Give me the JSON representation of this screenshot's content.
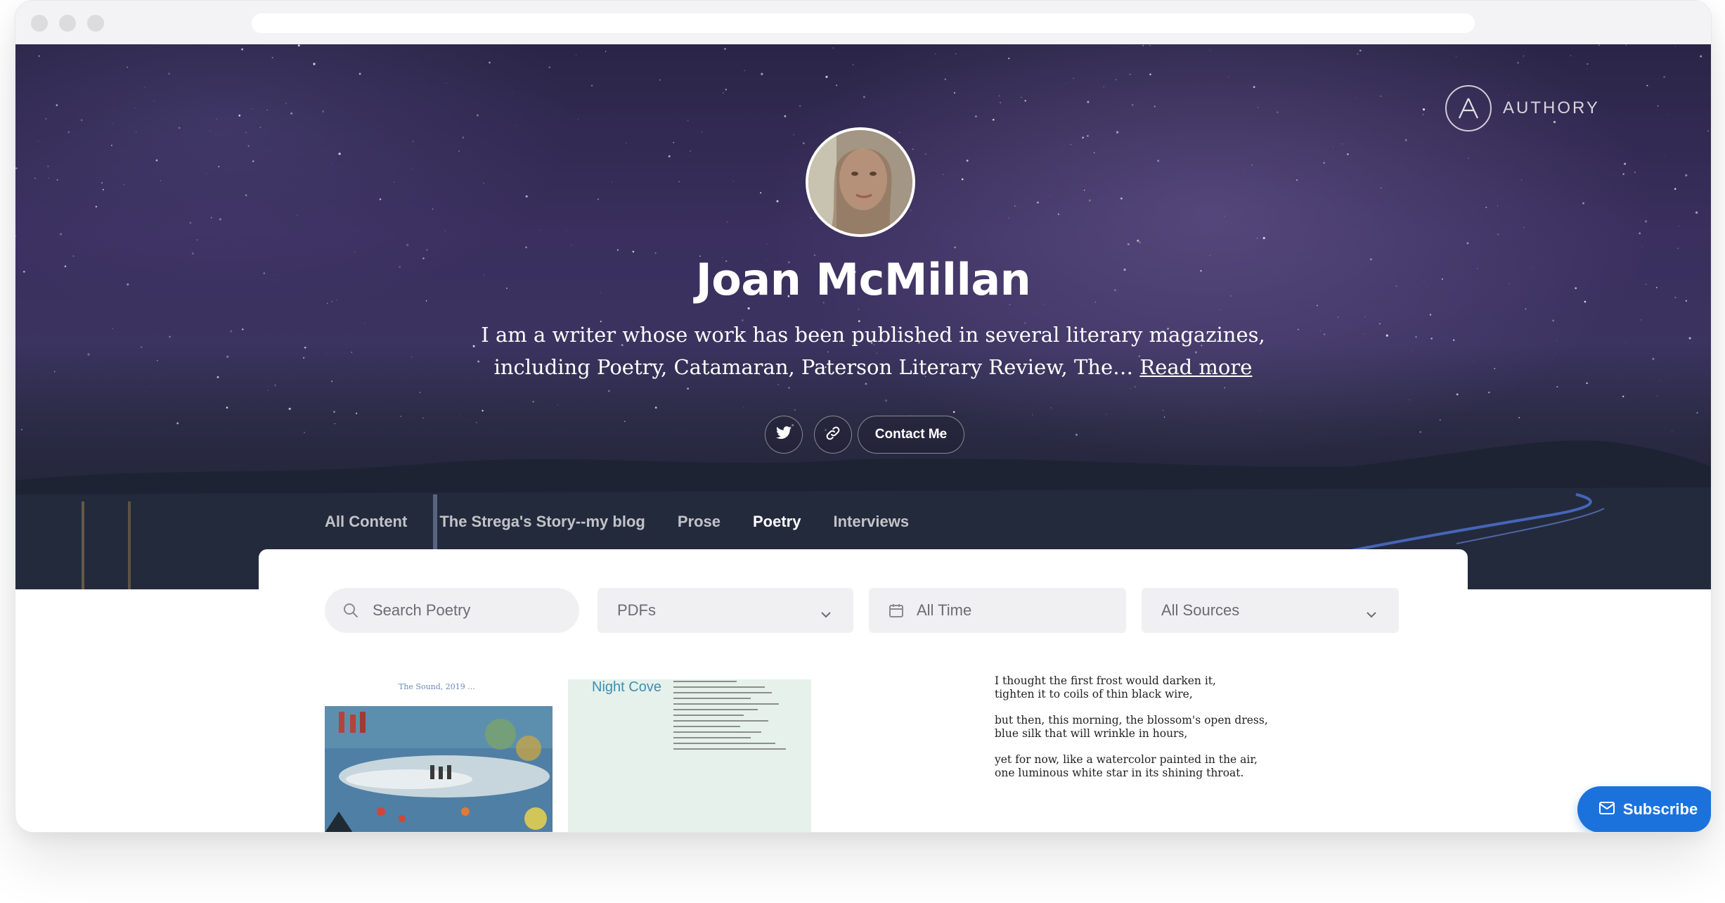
{
  "brand": {
    "name": "AUTHORY"
  },
  "profile": {
    "name": "Joan McMillan",
    "bio": "I am a writer whose work has been published in several literary magazines, including Poetry, Catamaran, Paterson Literary Review, The…",
    "read_more": "Read more",
    "contact_label": "Contact Me"
  },
  "social": [
    {
      "icon": "twitter-icon"
    },
    {
      "icon": "link-icon"
    }
  ],
  "tabs": [
    {
      "label": "All Content"
    },
    {
      "label": "The Strega's Story--my blog"
    },
    {
      "label": "Prose"
    },
    {
      "label": "Poetry",
      "active": true
    },
    {
      "label": "Interviews"
    }
  ],
  "filters": {
    "search_placeholder": "Search Poetry",
    "format": "PDFs",
    "time": "All Time",
    "sources": "All Sources"
  },
  "items": {
    "thumb1_caption": "The Sound, 2019 ...",
    "thumb2_title": "Night Cove",
    "poem_stanzas": [
      [
        "I thought the first frost would darken it,",
        "tighten it to coils of thin black wire,"
      ],
      [
        "but then, this morning, the blossom's open dress,",
        "blue silk that will wrinkle in hours,"
      ],
      [
        "yet for now, like a watercolor painted in the air,",
        "one luminous white star in its shining throat."
      ]
    ]
  },
  "subscribe_label": "Subscribe",
  "colors": {
    "accent": "#1b72dd",
    "tab_indicator": "#2f78e6"
  }
}
